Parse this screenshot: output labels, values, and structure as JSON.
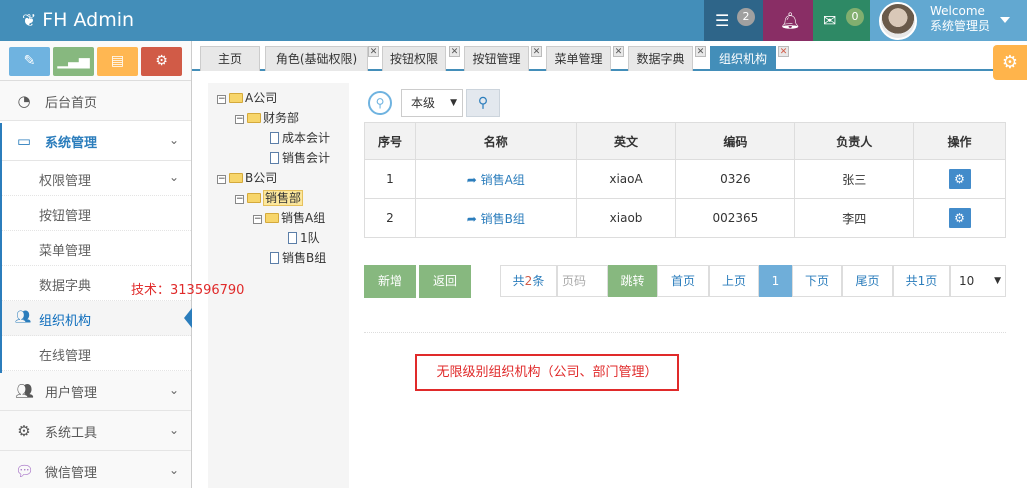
{
  "app": {
    "title": "FH Admin"
  },
  "navbar": {
    "tasks_count": "2",
    "notifications_count": "",
    "messages_count": "0",
    "welcome": "Welcome",
    "username": "系统管理员"
  },
  "sidebar": {
    "shortcuts": [
      {
        "icon": "pencil-icon",
        "color": "#6fb3e0"
      },
      {
        "icon": "signal-icon",
        "color": "#87b87f"
      },
      {
        "icon": "book-icon",
        "color": "#ffb752"
      },
      {
        "icon": "cogs-icon",
        "color": "#d15b47"
      }
    ],
    "items": [
      {
        "label": "后台首页"
      },
      {
        "label": "系统管理"
      },
      {
        "label": "用户管理"
      },
      {
        "label": "系统工具"
      },
      {
        "label": "微信管理"
      }
    ],
    "sub_items": [
      {
        "label": "权限管理"
      },
      {
        "label": "按钮管理"
      },
      {
        "label": "菜单管理"
      },
      {
        "label": "数据字典"
      },
      {
        "label": "组织机构"
      },
      {
        "label": "在线管理"
      }
    ]
  },
  "tabs": [
    {
      "label": "主页"
    },
    {
      "label": "角色(基础权限)"
    },
    {
      "label": "按钮权限"
    },
    {
      "label": "按钮管理"
    },
    {
      "label": "菜单管理"
    },
    {
      "label": "数据字典"
    },
    {
      "label": "组织机构"
    }
  ],
  "tree": {
    "nodes": [
      {
        "label": "A公司",
        "toggle": "−"
      },
      {
        "label": "财务部",
        "toggle": "−"
      },
      {
        "label": "成本会计"
      },
      {
        "label": "销售会计"
      },
      {
        "label": "B公司",
        "toggle": "−"
      },
      {
        "label": "销售部",
        "toggle": "−"
      },
      {
        "label": "销售A组",
        "toggle": "−"
      },
      {
        "label": "1队"
      },
      {
        "label": "销售B组"
      }
    ]
  },
  "search": {
    "level_value": "本级"
  },
  "table": {
    "headers": [
      "序号",
      "名称",
      "英文",
      "编码",
      "负责人",
      "操作"
    ],
    "rows": [
      {
        "index": "1",
        "name": "销售A组",
        "english": "xiaoA",
        "code": "0326",
        "owner": "张三"
      },
      {
        "index": "2",
        "name": "销售B组",
        "english": "xiaob",
        "code": "002365",
        "owner": "李四"
      }
    ]
  },
  "actions": {
    "add_label": "新增",
    "back_label": "返回"
  },
  "pager": {
    "total_prefix": "共",
    "total_count": "2",
    "total_suffix": "条",
    "page_placeholder": "页码",
    "jump": "跳转",
    "first": "首页",
    "prev": "上页",
    "current": "1",
    "next": "下页",
    "last": "尾页",
    "pages": "共1页",
    "page_size": "10"
  },
  "annotations": {
    "tech_note": "技术：313596790",
    "feature_note": "无限级别组织机构（公司、部门管理）"
  },
  "colors": {
    "navbar": "#438eb9",
    "accent": "#2b7dbc",
    "annotation": "#e02a2a",
    "green_button": "#87b87f"
  }
}
